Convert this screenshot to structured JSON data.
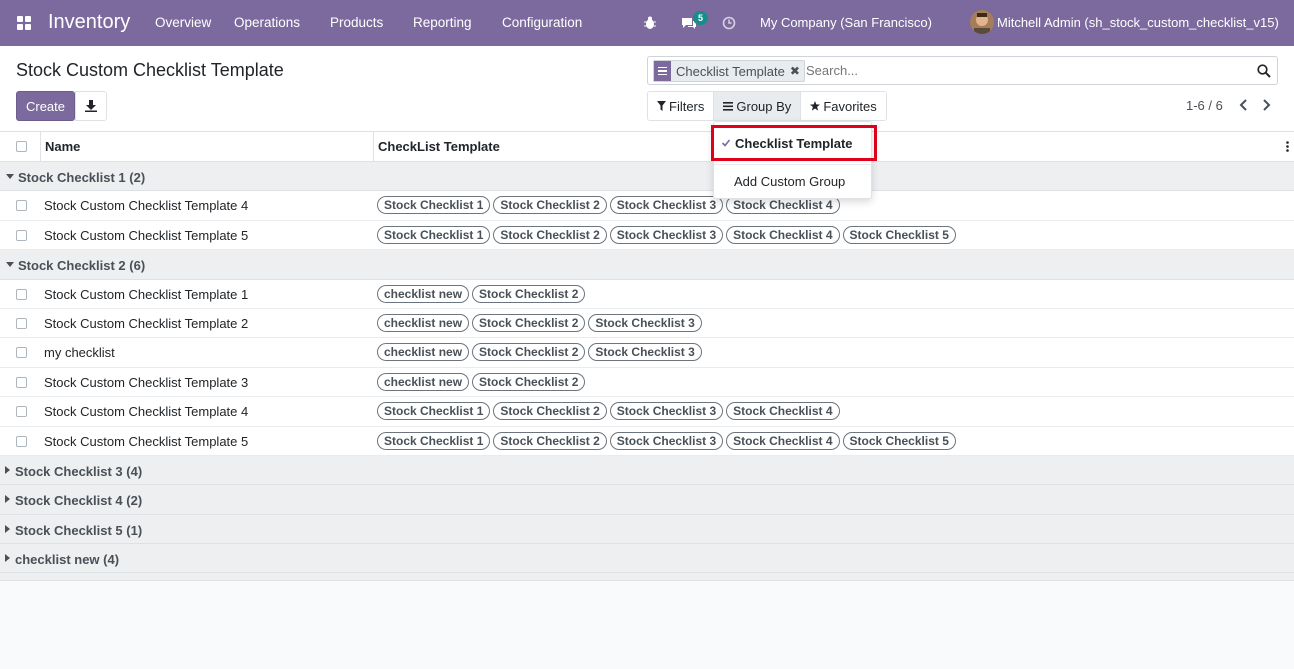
{
  "navbar": {
    "app_title": "Inventory",
    "menu": [
      "Overview",
      "Operations",
      "Products",
      "Reporting",
      "Configuration"
    ],
    "chat_count": "5",
    "company": "My Company (San Francisco)",
    "user": "Mitchell Admin (sh_stock_custom_checklist_v15)"
  },
  "control": {
    "title": "Stock Custom Checklist Template",
    "create_label": "Create",
    "facet_label": "Checklist Template",
    "search_placeholder": "Search...",
    "filters_label": "Filters",
    "groupby_label": "Group By",
    "favorites_label": "Favorites",
    "pager": "1-6 / 6"
  },
  "table": {
    "columns": [
      "Name",
      "CheckList Template"
    ],
    "groups": [
      {
        "label": "Stock Checklist 1 (2)",
        "expanded": true,
        "rows": [
          {
            "name": "Stock Custom Checklist Template 4",
            "tags": [
              "Stock Checklist 1",
              "Stock Checklist 2",
              "Stock Checklist 3",
              "Stock Checklist 4"
            ]
          },
          {
            "name": "Stock Custom Checklist Template 5",
            "tags": [
              "Stock Checklist 1",
              "Stock Checklist 2",
              "Stock Checklist 3",
              "Stock Checklist 4",
              "Stock Checklist 5"
            ]
          }
        ]
      },
      {
        "label": "Stock Checklist 2 (6)",
        "expanded": true,
        "rows": [
          {
            "name": "Stock Custom Checklist Template 1",
            "tags": [
              "checklist new",
              "Stock Checklist 2"
            ]
          },
          {
            "name": "Stock Custom Checklist Template 2",
            "tags": [
              "checklist new",
              "Stock Checklist 2",
              "Stock Checklist 3"
            ]
          },
          {
            "name": "my checklist",
            "tags": [
              "checklist new",
              "Stock Checklist 2",
              "Stock Checklist 3"
            ]
          },
          {
            "name": "Stock Custom Checklist Template 3",
            "tags": [
              "checklist new",
              "Stock Checklist 2"
            ]
          },
          {
            "name": "Stock Custom Checklist Template 4",
            "tags": [
              "Stock Checklist 1",
              "Stock Checklist 2",
              "Stock Checklist 3",
              "Stock Checklist 4"
            ]
          },
          {
            "name": "Stock Custom Checklist Template 5",
            "tags": [
              "Stock Checklist 1",
              "Stock Checklist 2",
              "Stock Checklist 3",
              "Stock Checklist 4",
              "Stock Checklist 5"
            ]
          }
        ]
      },
      {
        "label": "Stock Checklist 3 (4)",
        "expanded": false,
        "rows": []
      },
      {
        "label": "Stock Checklist 4 (2)",
        "expanded": false,
        "rows": []
      },
      {
        "label": "Stock Checklist 5 (1)",
        "expanded": false,
        "rows": []
      },
      {
        "label": "checklist new (4)",
        "expanded": false,
        "rows": []
      }
    ]
  },
  "dropdown": {
    "selected_item": "Checklist Template",
    "custom_group": "Add Custom Group"
  },
  "colors": {
    "brand": "#7c6a9e",
    "highlight": "#e0001a"
  }
}
